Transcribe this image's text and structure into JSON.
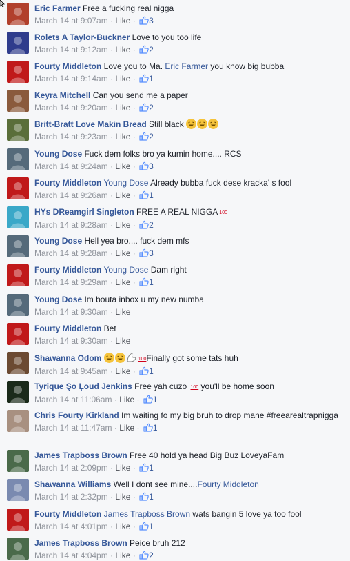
{
  "comments": [
    {
      "author": "Eric Farmer",
      "segments": [
        {
          "t": "text",
          "v": " Free a fucking real nigga"
        }
      ],
      "time": "March 14 at 9:07am",
      "like_label": "Like",
      "likes": "3",
      "avatar_color": "#b1402c"
    },
    {
      "author": "Rolets A Taylor-Buckner",
      "segments": [
        {
          "t": "text",
          "v": " Love to you too life"
        }
      ],
      "time": "March 14 at 9:12am",
      "like_label": "Like",
      "likes": "2",
      "avatar_color": "#2f3c8c"
    },
    {
      "author": "Fourty Middleton",
      "segments": [
        {
          "t": "text",
          "v": " Love you to Ma. "
        },
        {
          "t": "mention",
          "v": "Eric Farmer"
        },
        {
          "t": "text",
          "v": " you know big bubba"
        }
      ],
      "time": "March 14 at 9:14am",
      "like_label": "Like",
      "likes": "1",
      "avatar_color": "#c0191a"
    },
    {
      "author": "Keyra Mitchell",
      "segments": [
        {
          "t": "text",
          "v": " Can you send me a paper"
        }
      ],
      "time": "March 14 at 9:20am",
      "like_label": "Like",
      "likes": "2",
      "avatar_color": "#8a5a3c"
    },
    {
      "author": "Britt-Bratt Love Makin Bread",
      "segments": [
        {
          "t": "text",
          "v": " Still black "
        },
        {
          "t": "emoji",
          "v": "3"
        }
      ],
      "time": "March 14 at 9:23am",
      "like_label": "Like",
      "likes": "2",
      "avatar_color": "#5a6e3a"
    },
    {
      "author": "Young Dose",
      "segments": [
        {
          "t": "text",
          "v": " Fuck dem folks bro ya kumin home.... RCS"
        }
      ],
      "time": "March 14 at 9:24am",
      "like_label": "Like",
      "likes": "3",
      "avatar_color": "#556a7a"
    },
    {
      "author": "Fourty Middleton",
      "segments": [
        {
          "t": "text",
          "v": " "
        },
        {
          "t": "mention",
          "v": "Young Dose"
        },
        {
          "t": "text",
          "v": " Already bubba fuck dese kracka' s fool"
        }
      ],
      "time": "March 14 at 9:26am",
      "like_label": "Like",
      "likes": "1",
      "avatar_color": "#c0191a"
    },
    {
      "author": "HYs DReamgirl Singleton",
      "segments": [
        {
          "t": "text",
          "v": " FREE A REAL NIGGA"
        },
        {
          "t": "hundred",
          "v": "100"
        }
      ],
      "time": "March 14 at 9:28am",
      "like_label": "Like",
      "likes": "2",
      "avatar_color": "#3aa8c8"
    },
    {
      "author": "Young Dose",
      "segments": [
        {
          "t": "text",
          "v": " Hell yea bro.... fuck dem mfs"
        }
      ],
      "time": "March 14 at 9:28am",
      "like_label": "Like",
      "likes": "3",
      "avatar_color": "#556a7a"
    },
    {
      "author": "Fourty Middleton",
      "segments": [
        {
          "t": "text",
          "v": " "
        },
        {
          "t": "mention",
          "v": "Young Dose"
        },
        {
          "t": "text",
          "v": " Dam right"
        }
      ],
      "time": "March 14 at 9:29am",
      "like_label": "Like",
      "likes": "1",
      "avatar_color": "#c0191a"
    },
    {
      "author": "Young Dose",
      "segments": [
        {
          "t": "text",
          "v": " Im bouta inbox u my new numba"
        }
      ],
      "time": "March 14 at 9:30am",
      "like_label": "Like",
      "likes": "",
      "avatar_color": "#556a7a"
    },
    {
      "author": "Fourty Middleton",
      "segments": [
        {
          "t": "text",
          "v": " Bet"
        }
      ],
      "time": "March 14 at 9:30am",
      "like_label": "Like",
      "likes": "",
      "avatar_color": "#c0191a"
    },
    {
      "author": "Shawanna Odom",
      "segments": [
        {
          "t": "text",
          "v": " "
        },
        {
          "t": "emoji",
          "v": "2"
        },
        {
          "t": "hand",
          "v": ""
        },
        {
          "t": "hundred",
          "v": "100"
        },
        {
          "t": "text",
          "v": "Finally got some tats huh"
        }
      ],
      "time": "March 14 at 9:45am",
      "like_label": "Like",
      "likes": "1",
      "avatar_color": "#6b4a32"
    },
    {
      "author": "Tyrique Şo Ļoud Jenkins",
      "segments": [
        {
          "t": "text",
          "v": " Free yah cuzo "
        },
        {
          "t": "hundred",
          "v": "100"
        },
        {
          "t": "text",
          "v": " you'll be home soon"
        }
      ],
      "time": "March 14 at 11:06am",
      "like_label": "Like",
      "likes": "1",
      "avatar_color": "#1a2a1a"
    },
    {
      "author": "Chris Fourty Kirkland",
      "segments": [
        {
          "t": "text",
          "v": " Im waiting fo my big bruh to drop mane #freearealtrapnigga"
        }
      ],
      "wrap": true,
      "time": "March 14 at 11:47am",
      "like_label": "Like",
      "likes": "1",
      "avatar_color": "#a89080"
    },
    {
      "author": "James Trapboss Brown",
      "segments": [
        {
          "t": "text",
          "v": " Free 40 hold ya head Big Buz LoveyaFam"
        }
      ],
      "time": "March 14 at 2:09pm",
      "like_label": "Like",
      "likes": "1",
      "avatar_color": "#4a6a4a"
    },
    {
      "author": "Shawanna Williams",
      "segments": [
        {
          "t": "text",
          "v": " Well I dont see mine...."
        },
        {
          "t": "mention",
          "v": "Fourty Middleton"
        }
      ],
      "time": "March 14 at 2:32pm",
      "like_label": "Like",
      "likes": "1",
      "avatar_color": "#7a8ab0"
    },
    {
      "author": "Fourty Middleton",
      "segments": [
        {
          "t": "text",
          "v": " "
        },
        {
          "t": "mention",
          "v": "James Trapboss Brown"
        },
        {
          "t": "text",
          "v": " wats bangin 5 love ya too fool"
        }
      ],
      "time": "March 14 at 4:01pm",
      "like_label": "Like",
      "likes": "1",
      "avatar_color": "#c0191a"
    },
    {
      "author": "James Trapboss Brown",
      "segments": [
        {
          "t": "text",
          "v": " Peice bruh 212"
        }
      ],
      "time": "March 14 at 4:04pm",
      "like_label": "Like",
      "likes": "2",
      "avatar_color": "#4a6a4a"
    }
  ],
  "separator": " · "
}
